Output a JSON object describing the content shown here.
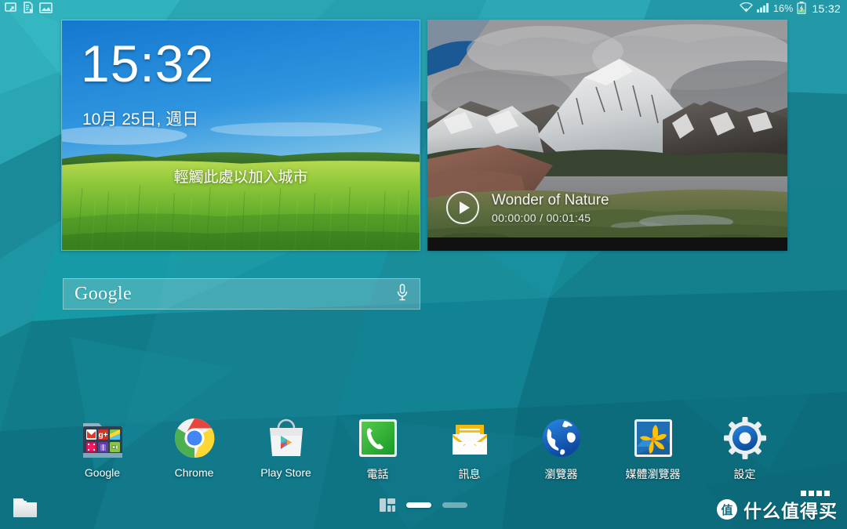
{
  "status_bar": {
    "notification_icons": [
      "screen-mirror-icon",
      "document-error-icon",
      "image-icon"
    ],
    "wifi_icon": "wifi-icon",
    "signal_icon": "cellular-signal-icon",
    "battery_percent": "16%",
    "battery_icon": "battery-charging-icon",
    "clock": "15:32"
  },
  "clock_widget": {
    "time": "15:32",
    "date": "10月 25日, 週日",
    "city_hint": "輕觸此處以加入城市"
  },
  "video_widget": {
    "title": "Wonder of Nature",
    "time_display": "00:00:00 / 00:01:45",
    "play_icon": "play-icon"
  },
  "search_widget": {
    "logo_text": "Google",
    "mic_icon": "microphone-icon"
  },
  "dock": {
    "apps": [
      {
        "label": "Google",
        "icon": "google-folder-icon"
      },
      {
        "label": "Chrome",
        "icon": "chrome-icon"
      },
      {
        "label": "Play Store",
        "icon": "play-store-icon"
      },
      {
        "label": "電話",
        "icon": "phone-icon"
      },
      {
        "label": "訊息",
        "icon": "messages-icon"
      },
      {
        "label": "瀏覽器",
        "icon": "browser-globe-icon"
      },
      {
        "label": "媒體瀏覽器",
        "icon": "media-browser-icon"
      },
      {
        "label": "設定",
        "icon": "settings-gear-icon"
      }
    ]
  },
  "bottom_bar": {
    "file_manager_icon": "folder-icon",
    "home_screen_icon": "home-grid-icon",
    "page_count": 2,
    "active_page": 1
  },
  "watermark": {
    "badge_text": "值",
    "text": "什么值得买"
  },
  "colors": {
    "wallpaper_teal": "#1d8d9c",
    "wallpaper_teal_dark": "#12707f",
    "wallpaper_teal_light": "#2aa9b5",
    "accent_white": "#ffffff",
    "status_bar_text": "#ffffff",
    "video_bar_black": "#111111"
  }
}
